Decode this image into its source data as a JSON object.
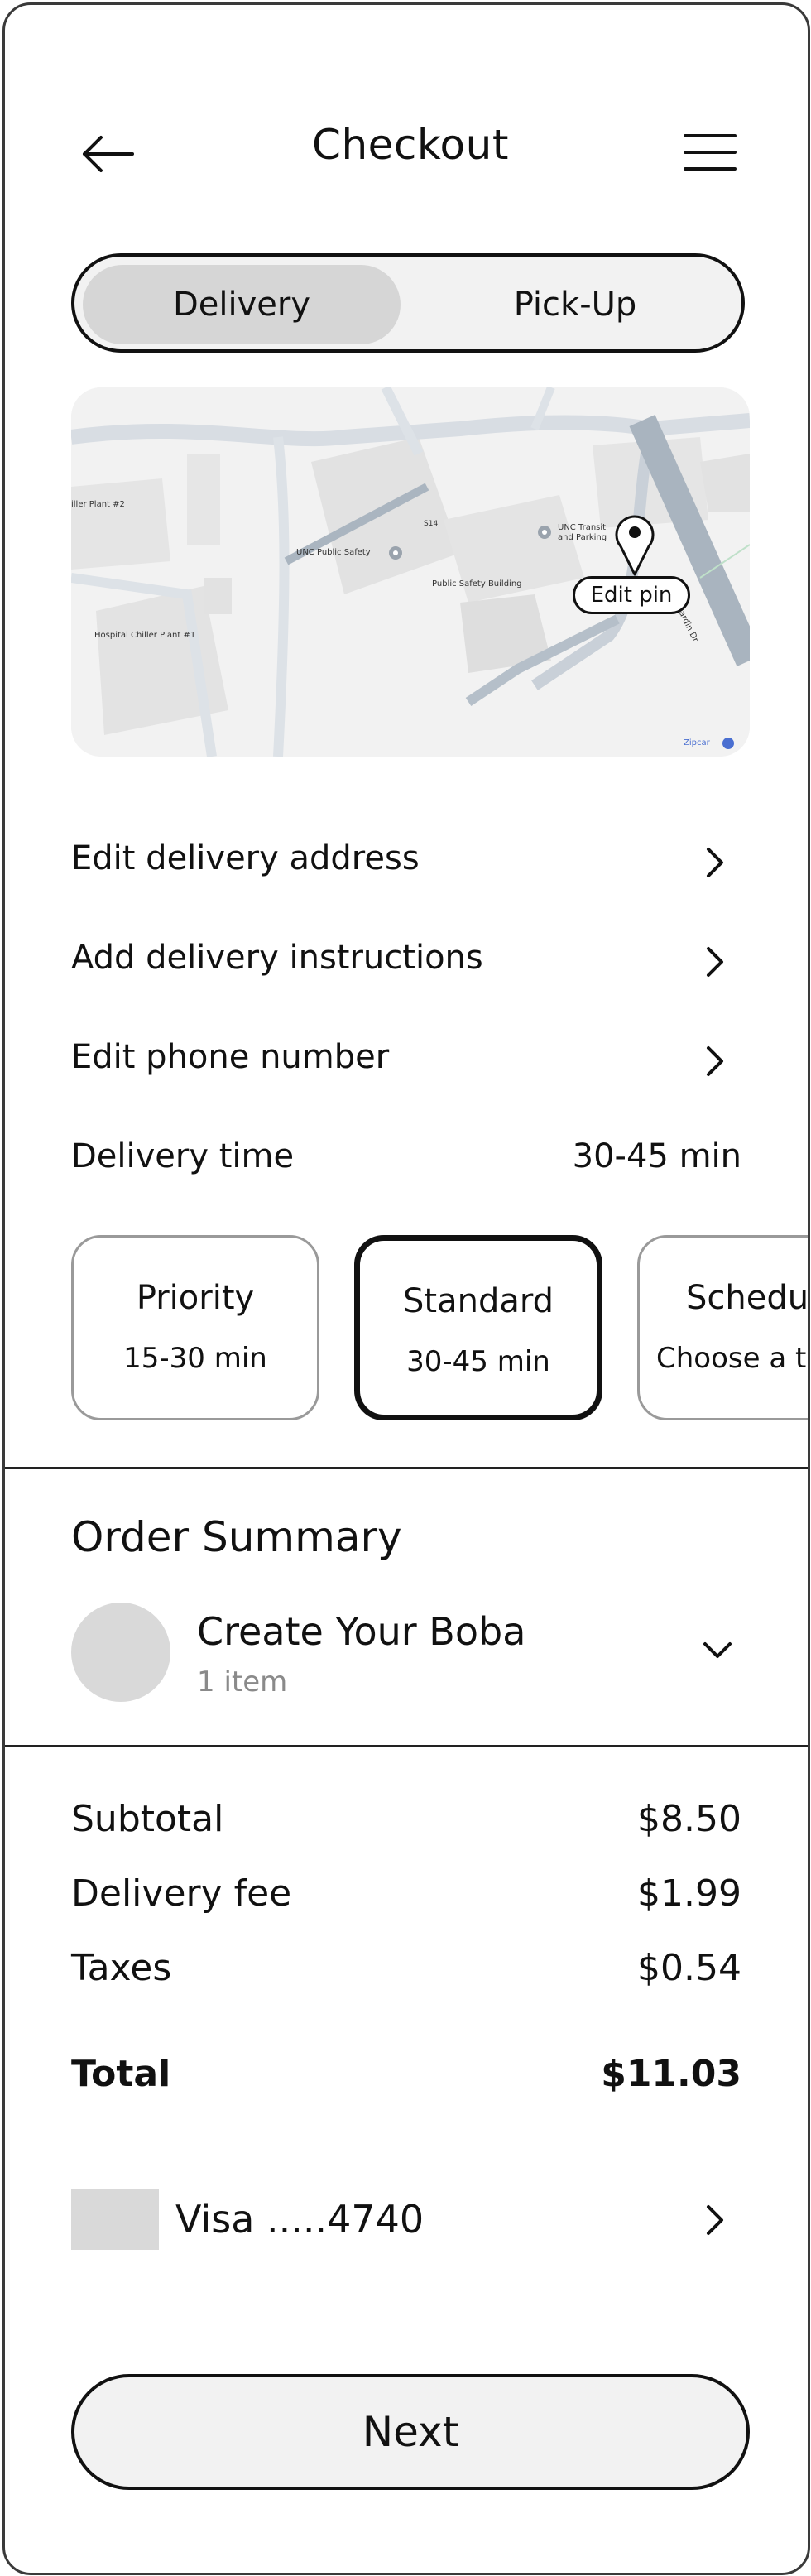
{
  "header": {
    "title": "Checkout",
    "back_icon": "arrow-left-icon",
    "menu_icon": "hamburger-menu-icon"
  },
  "toggle": {
    "options": [
      "Delivery",
      "Pick-Up"
    ],
    "selected": "Delivery"
  },
  "map": {
    "labels": {
      "plant2": "iller Plant #2",
      "safety": "UNC Public Safety",
      "s14": "S14",
      "transit": "UNC Transit and Parking",
      "building": "Public Safety Building",
      "plant1": "Hospital Chiller Plant #1",
      "road": "Paul Hardin Dr",
      "zipcar": "Zipcar"
    },
    "edit_pin_label": "Edit pin"
  },
  "rows": {
    "edit_address": "Edit delivery address",
    "add_instructions": "Add delivery instructions",
    "edit_phone": "Edit phone number",
    "delivery_time_label": "Delivery time",
    "delivery_time_value": "30-45 min"
  },
  "delivery_options": [
    {
      "title": "Priority",
      "subtitle": "15-30 min"
    },
    {
      "title": "Standard",
      "subtitle": "30-45 min"
    },
    {
      "title": "Schedu",
      "subtitle": "Choose a t"
    }
  ],
  "order_summary": {
    "title": "Order Summary",
    "item_name": "Create Your Boba",
    "item_count": "1 item"
  },
  "totals": {
    "subtotal_label": "Subtotal",
    "subtotal_value": "$8.50",
    "delivery_fee_label": "Delivery fee",
    "delivery_fee_value": "$1.99",
    "taxes_label": "Taxes",
    "taxes_value": "$0.54",
    "total_label": "Total",
    "total_value": "$11.03"
  },
  "payment": {
    "card_label": "Visa .....4740"
  },
  "footer": {
    "next_label": "Next"
  }
}
